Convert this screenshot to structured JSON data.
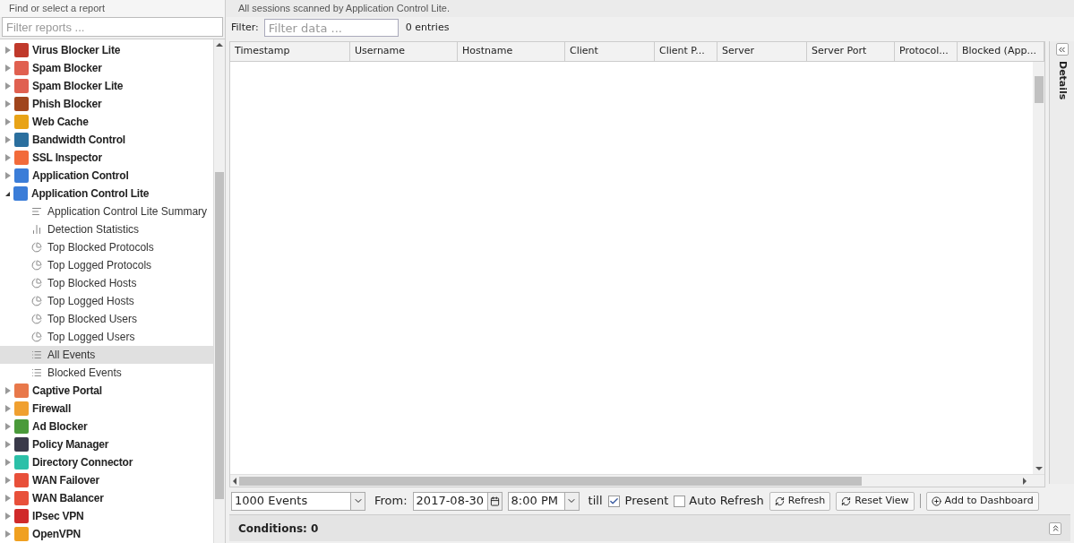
{
  "sidebar": {
    "title": "Find or select a report",
    "filter": {
      "placeholder": "Filter reports ..."
    },
    "items": [
      {
        "label": "Virus Blocker Lite",
        "color": "#c0392b",
        "expanded": false
      },
      {
        "label": "Spam Blocker",
        "color": "#e06050",
        "expanded": false
      },
      {
        "label": "Spam Blocker Lite",
        "color": "#e06050",
        "expanded": false
      },
      {
        "label": "Phish Blocker",
        "color": "#a0451c",
        "expanded": false
      },
      {
        "label": "Web Cache",
        "color": "#e8a317",
        "expanded": false
      },
      {
        "label": "Bandwidth Control",
        "color": "#2b6f9e",
        "expanded": false
      },
      {
        "label": "SSL Inspector",
        "color": "#f26b3a",
        "expanded": false
      },
      {
        "label": "Application Control",
        "color": "#3b7dd8",
        "expanded": false
      },
      {
        "label": "Application Control Lite",
        "color": "#3b7dd8",
        "expanded": true,
        "children": [
          {
            "label": "Application Control Lite Summary",
            "kind": "text",
            "selected": false
          },
          {
            "label": "Detection Statistics",
            "kind": "bars",
            "selected": false
          },
          {
            "label": "Top Blocked Protocols",
            "kind": "pie",
            "selected": false
          },
          {
            "label": "Top Logged Protocols",
            "kind": "pie",
            "selected": false
          },
          {
            "label": "Top Blocked Hosts",
            "kind": "pie",
            "selected": false
          },
          {
            "label": "Top Logged Hosts",
            "kind": "pie",
            "selected": false
          },
          {
            "label": "Top Blocked Users",
            "kind": "pie",
            "selected": false
          },
          {
            "label": "Top Logged Users",
            "kind": "pie",
            "selected": false
          },
          {
            "label": "All Events",
            "kind": "list",
            "selected": true
          },
          {
            "label": "Blocked Events",
            "kind": "list",
            "selected": false
          }
        ]
      },
      {
        "label": "Captive Portal",
        "color": "#e8784a",
        "expanded": false
      },
      {
        "label": "Firewall",
        "color": "#f0a030",
        "expanded": false
      },
      {
        "label": "Ad Blocker",
        "color": "#4a9a3a",
        "expanded": false
      },
      {
        "label": "Policy Manager",
        "color": "#3a3a4a",
        "expanded": false
      },
      {
        "label": "Directory Connector",
        "color": "#2cc0a8",
        "expanded": false
      },
      {
        "label": "WAN Failover",
        "color": "#e8503a",
        "expanded": false
      },
      {
        "label": "WAN Balancer",
        "color": "#e8503a",
        "expanded": false
      },
      {
        "label": "IPsec VPN",
        "color": "#d02a2a",
        "expanded": false
      },
      {
        "label": "OpenVPN",
        "color": "#f0a020",
        "expanded": false
      }
    ]
  },
  "report": {
    "description": "All sessions scanned by Application Control Lite.",
    "filter": {
      "label": "Filter:",
      "placeholder": "Filter data ...",
      "count": "0 entries"
    },
    "table": {
      "columns": [
        "Timestamp",
        "Username",
        "Hostname",
        "Client",
        "Client P...",
        "Server",
        "Server Port",
        "Protocol...",
        "Blocked (App..."
      ]
    },
    "toolbar": {
      "limit": "1000 Events",
      "from_label": "From:",
      "date": "2017-08-30",
      "time": "8:00 PM",
      "till_label": "till",
      "present": {
        "label": "Present",
        "checked": true
      },
      "auto_refresh": {
        "label": "Auto Refresh",
        "checked": false
      },
      "refresh": "Refresh",
      "reset_view": "Reset View",
      "add_to_dashboard": "Add to Dashboard"
    },
    "conditions": "Conditions: 0"
  },
  "details_panel": {
    "title": "Details"
  }
}
